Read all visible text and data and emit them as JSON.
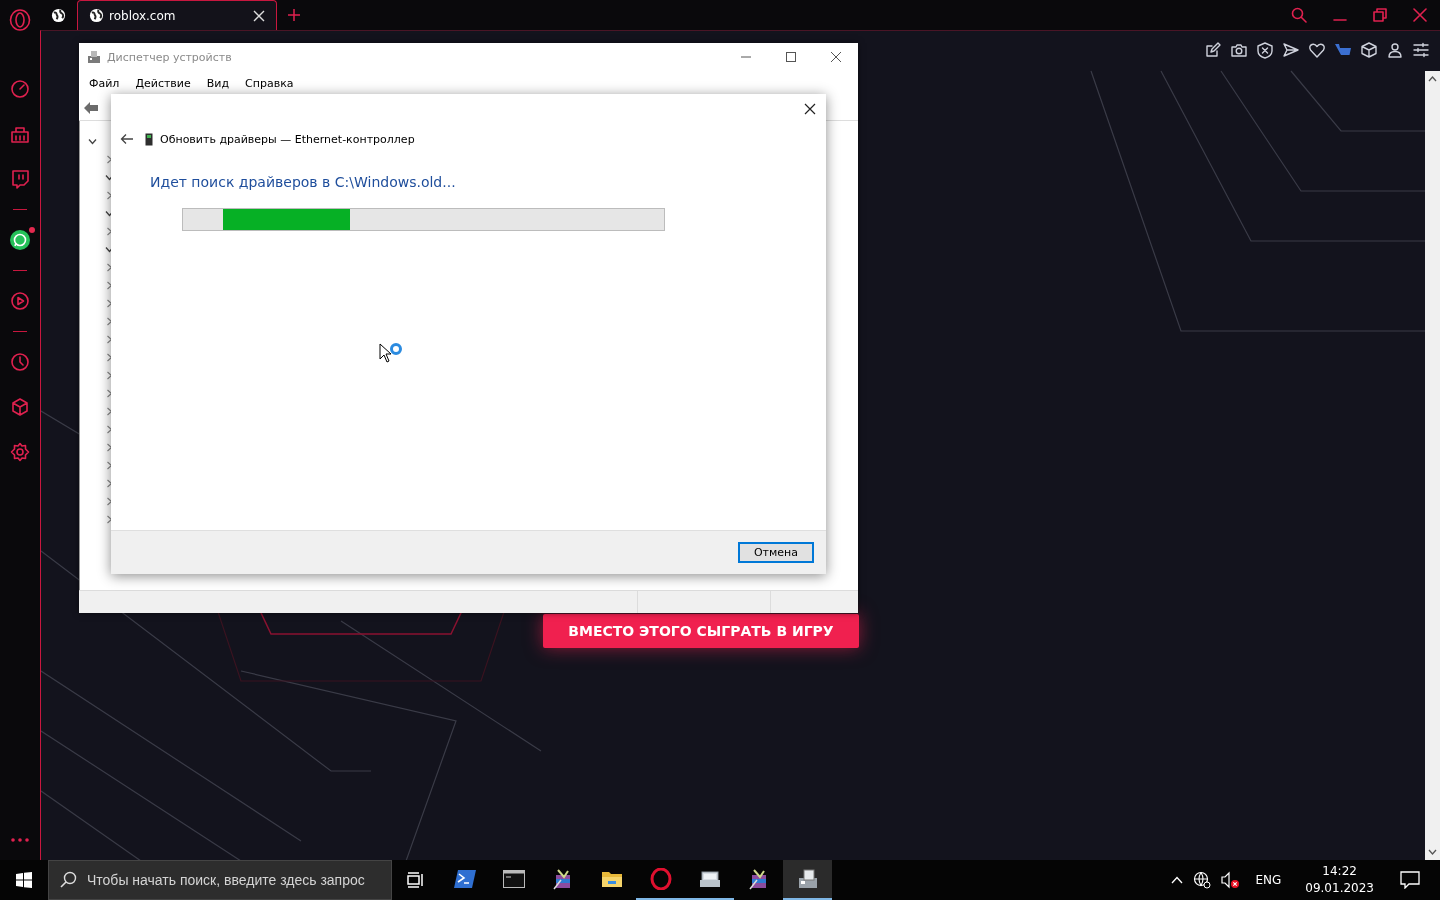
{
  "tabs": [
    {
      "selected": false
    },
    {
      "label": "roblox.com",
      "selected": true
    }
  ],
  "sidebar": {
    "items": [
      {
        "kind": "icon",
        "notification": false
      },
      {
        "kind": "icon",
        "notification": false
      },
      {
        "kind": "icon",
        "notification": false
      },
      {
        "kind": "divider"
      },
      {
        "kind": "icon",
        "notification": true
      },
      {
        "kind": "divider"
      },
      {
        "kind": "icon",
        "notification": false
      },
      {
        "kind": "divider"
      },
      {
        "kind": "icon",
        "notification": false
      },
      {
        "kind": "icon",
        "notification": false
      },
      {
        "kind": "icon",
        "notification": false
      }
    ]
  },
  "page": {
    "play_button": "ВМЕСТО ЭТОГО СЫГРАТЬ В ИГРУ"
  },
  "device_manager": {
    "title": "Диспетчер устройств",
    "menu": [
      "Файл",
      "Действие",
      "Вид",
      "Справка"
    ],
    "tree": {
      "expanded": true,
      "children": [
        {
          "expanded": false
        },
        {
          "expanded": true
        },
        {
          "expanded": false
        },
        {
          "expanded": true
        },
        {
          "expanded": false
        },
        {
          "expanded": true
        },
        {
          "expanded": false
        },
        {
          "expanded": false
        },
        {
          "expanded": false
        },
        {
          "expanded": false
        },
        {
          "expanded": false
        },
        {
          "expanded": false
        },
        {
          "expanded": false
        },
        {
          "expanded": false
        },
        {
          "expanded": false
        },
        {
          "expanded": false
        },
        {
          "expanded": false
        },
        {
          "expanded": false
        },
        {
          "expanded": false
        },
        {
          "expanded": false
        },
        {
          "expanded": false
        }
      ]
    }
  },
  "dialog": {
    "title": "Обновить драйверы — Ethernet-контроллер",
    "heading": "Идет поиск драйверов в C:\\Windows.old...",
    "progress": {
      "kind": "marquee"
    },
    "buttons": [
      {
        "label": "Отмена",
        "focused": true
      }
    ]
  },
  "taskbar": {
    "search": {
      "placeholder": "Чтобы начать поиск, введите здесь запрос"
    },
    "apps": [
      {
        "running": false,
        "selected": false
      },
      {
        "running": false,
        "selected": false
      },
      {
        "running": false,
        "selected": false
      },
      {
        "running": false,
        "selected": false
      },
      {
        "running": true,
        "selected": false
      },
      {
        "running": true,
        "selected": false
      },
      {
        "running": false,
        "selected": false
      },
      {
        "running": true,
        "selected": true
      }
    ],
    "tray": {
      "language": "ENG",
      "time": "14:22",
      "date": "09.01.2023",
      "sound_muted": true
    }
  }
}
